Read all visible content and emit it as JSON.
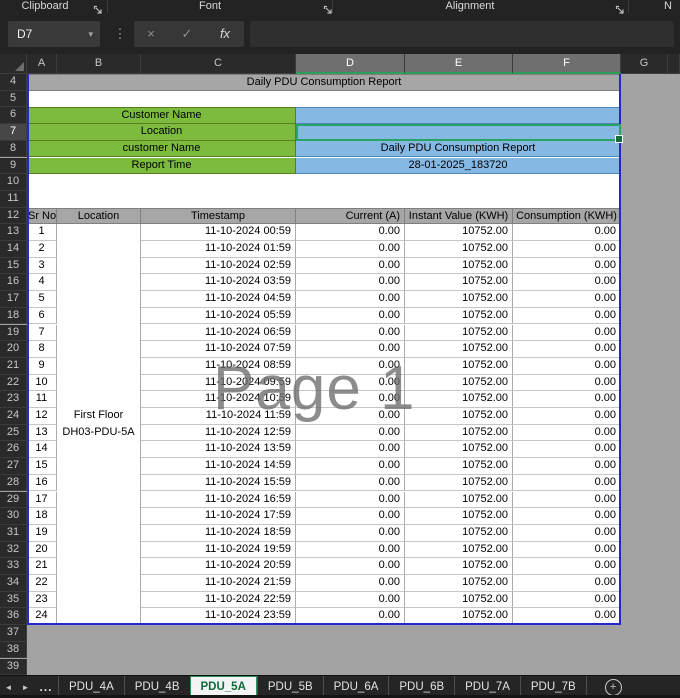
{
  "ribbon": {
    "groups": [
      {
        "label": "Clipboard",
        "launcher": true
      },
      {
        "label": "Font",
        "launcher": true
      },
      {
        "label": "Alignment",
        "launcher": true
      },
      {
        "label": "N",
        "launcher": false
      }
    ]
  },
  "formula_bar": {
    "name_box": "D7",
    "formula_value": ""
  },
  "icons": {
    "name_box_caret": "▾",
    "more": "⋮",
    "cancel": "×",
    "enter": "✓",
    "fx": "fx",
    "nav_left": "◄",
    "nav_right": "►",
    "overflow": "...",
    "add": "+"
  },
  "grid": {
    "columns": [
      "A",
      "B",
      "C",
      "D",
      "E",
      "F",
      "G"
    ],
    "selected_columns": [
      "D",
      "E",
      "F"
    ],
    "row_numbers": [
      4,
      5,
      6,
      7,
      8,
      9,
      10,
      11,
      12,
      13,
      14,
      15,
      16,
      17,
      18,
      19,
      20,
      21,
      22,
      23,
      24,
      25,
      26,
      27,
      28,
      29,
      30,
      31,
      32,
      33,
      34,
      35,
      36,
      37,
      38,
      39
    ],
    "selected_row": 7
  },
  "report": {
    "title": "Daily PDU Consumption Report",
    "fields": [
      {
        "label": "Customer Name",
        "value": "",
        "selected": false
      },
      {
        "label": "Location",
        "value": "",
        "selected": true
      },
      {
        "label": "customer Name",
        "value": "Daily PDU Consumption Report",
        "selected": false
      },
      {
        "label": "Report Time",
        "value": "28-01-2025_183720",
        "selected": false
      }
    ],
    "table": {
      "headers": [
        "Sr No",
        "Location",
        "Timestamp",
        "Current (A)",
        "Instant Value (KWH)",
        "Consumption (KWH)"
      ],
      "location": [
        "First Floor",
        "DH03-PDU-5A"
      ],
      "rows": [
        [
          "1",
          "11-10-2024 00:59",
          "0.00",
          "10752.00",
          "0.00"
        ],
        [
          "2",
          "11-10-2024 01:59",
          "0.00",
          "10752.00",
          "0.00"
        ],
        [
          "3",
          "11-10-2024 02:59",
          "0.00",
          "10752.00",
          "0.00"
        ],
        [
          "4",
          "11-10-2024 03:59",
          "0.00",
          "10752.00",
          "0.00"
        ],
        [
          "5",
          "11-10-2024 04:59",
          "0.00",
          "10752.00",
          "0.00"
        ],
        [
          "6",
          "11-10-2024 05:59",
          "0.00",
          "10752.00",
          "0.00"
        ],
        [
          "7",
          "11-10-2024 06:59",
          "0.00",
          "10752.00",
          "0.00"
        ],
        [
          "8",
          "11-10-2024 07:59",
          "0.00",
          "10752.00",
          "0.00"
        ],
        [
          "9",
          "11-10-2024 08:59",
          "0.00",
          "10752.00",
          "0.00"
        ],
        [
          "10",
          "11-10-2024 09:59",
          "0.00",
          "10752.00",
          "0.00"
        ],
        [
          "11",
          "11-10-2024 10:59",
          "0.00",
          "10752.00",
          "0.00"
        ],
        [
          "12",
          "11-10-2024 11:59",
          "0.00",
          "10752.00",
          "0.00"
        ],
        [
          "13",
          "11-10-2024 12:59",
          "0.00",
          "10752.00",
          "0.00"
        ],
        [
          "14",
          "11-10-2024 13:59",
          "0.00",
          "10752.00",
          "0.00"
        ],
        [
          "15",
          "11-10-2024 14:59",
          "0.00",
          "10752.00",
          "0.00"
        ],
        [
          "16",
          "11-10-2024 15:59",
          "0.00",
          "10752.00",
          "0.00"
        ],
        [
          "17",
          "11-10-2024 16:59",
          "0.00",
          "10752.00",
          "0.00"
        ],
        [
          "18",
          "11-10-2024 17:59",
          "0.00",
          "10752.00",
          "0.00"
        ],
        [
          "19",
          "11-10-2024 18:59",
          "0.00",
          "10752.00",
          "0.00"
        ],
        [
          "20",
          "11-10-2024 19:59",
          "0.00",
          "10752.00",
          "0.00"
        ],
        [
          "21",
          "11-10-2024 20:59",
          "0.00",
          "10752.00",
          "0.00"
        ],
        [
          "22",
          "11-10-2024 21:59",
          "0.00",
          "10752.00",
          "0.00"
        ],
        [
          "23",
          "11-10-2024 22:59",
          "0.00",
          "10752.00",
          "0.00"
        ],
        [
          "24",
          "11-10-2024 23:59",
          "0.00",
          "10752.00",
          "0.00"
        ]
      ]
    },
    "watermark": "Page 1"
  },
  "tabs": {
    "items": [
      {
        "label": "PDU_4A",
        "active": false
      },
      {
        "label": "PDU_4B",
        "active": false
      },
      {
        "label": "PDU_5A",
        "active": true
      },
      {
        "label": "PDU_5B",
        "active": false
      },
      {
        "label": "PDU_6A",
        "active": false
      },
      {
        "label": "PDU_6B",
        "active": false
      },
      {
        "label": "PDU_7A",
        "active": false
      },
      {
        "label": "PDU_7B",
        "active": false
      }
    ]
  },
  "colors": {
    "label_green": "#7cbb3d",
    "value_blue": "#85b9e4",
    "header_gray": "#a6a6a6",
    "page_break_blue": "#2626cf",
    "selection_green": "#27a463",
    "outside_area_gray": "#a3a3a3",
    "active_tab_green": "#0e6b3c"
  }
}
